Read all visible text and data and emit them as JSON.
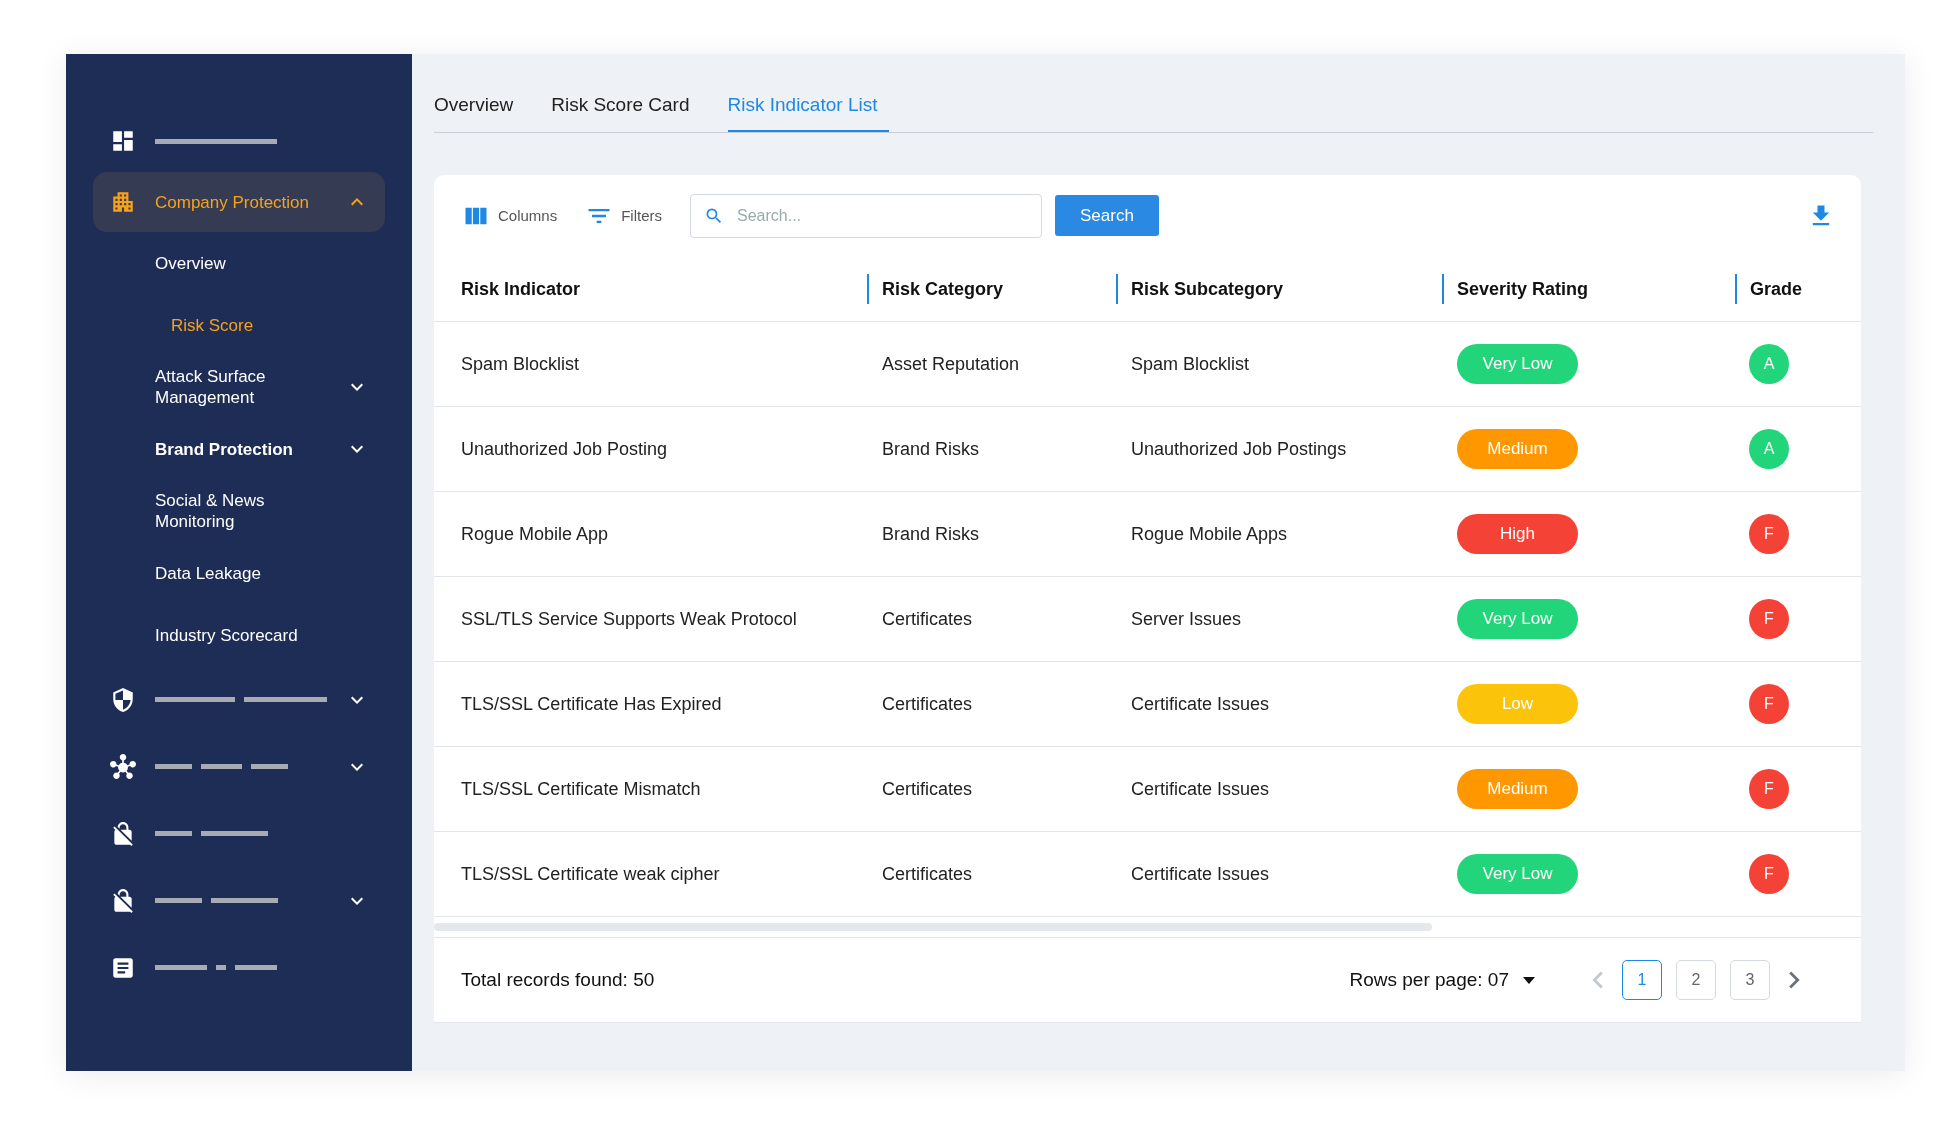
{
  "sidebar": {
    "items": [
      {
        "kind": "dashboard",
        "expandable": false
      },
      {
        "kind": "group",
        "label": "Company Protection",
        "selected": true,
        "expanded": true,
        "children": [
          {
            "label": "Overview",
            "selected": false,
            "expandable": false,
            "children": [
              {
                "label": "Risk Score",
                "selected": true
              }
            ]
          },
          {
            "label": "Attack Surface Management",
            "selected": false,
            "expandable": true
          },
          {
            "label": "Brand Protection",
            "selected": false,
            "expandable": true
          },
          {
            "label": "Social & News Monitoring",
            "selected": false,
            "expandable": false
          },
          {
            "label": "Data Leakage",
            "selected": false,
            "expandable": false
          },
          {
            "label": "Industry Scorecard",
            "selected": false,
            "expandable": false
          }
        ]
      },
      {
        "kind": "shield",
        "expandable": true
      },
      {
        "kind": "hub",
        "expandable": true
      },
      {
        "kind": "no-lock",
        "expandable": false
      },
      {
        "kind": "no-lock",
        "expandable": true
      },
      {
        "kind": "article",
        "expandable": false
      }
    ]
  },
  "tabs": [
    {
      "label": "Overview",
      "selected": false
    },
    {
      "label": "Risk Score Card",
      "selected": false
    },
    {
      "label": "Risk Indicator List",
      "selected": true
    }
  ],
  "toolbar": {
    "columns_button": "Columns",
    "filters_button": "Filters",
    "search": {
      "placeholder": "Search..."
    },
    "search_button": "Search"
  },
  "table": {
    "columns": [
      "Risk Indicator",
      "Risk Category",
      "Risk Subcategory",
      "Severity Rating",
      "Grade"
    ],
    "rows": [
      {
        "indicator": "Spam Blocklist",
        "category": "Asset Reputation",
        "subcategory": "Spam Blocklist",
        "severity": {
          "label": "Very Low",
          "color": "#23d57a"
        },
        "grade": {
          "label": "A",
          "color": "#23d57a"
        }
      },
      {
        "indicator": "Unauthorized Job Posting",
        "category": "Brand Risks",
        "subcategory": "Unauthorized Job Postings",
        "severity": {
          "label": "Medium",
          "color": "#ff9800"
        },
        "grade": {
          "label": "A",
          "color": "#23d57a"
        }
      },
      {
        "indicator": "Rogue Mobile App",
        "category": "Brand Risks",
        "subcategory": "Rogue Mobile Apps",
        "severity": {
          "label": "High",
          "color": "#f44336"
        },
        "grade": {
          "label": "F",
          "color": "#f44336"
        }
      },
      {
        "indicator": "SSL/TLS Service Supports Weak Protocol",
        "category": "Certificates",
        "subcategory": "Server Issues",
        "severity": {
          "label": "Very Low",
          "color": "#23d57a"
        },
        "grade": {
          "label": "F",
          "color": "#f44336"
        }
      },
      {
        "indicator": "TLS/SSL Certificate Has Expired",
        "category": "Certificates",
        "subcategory": "Certificate Issues",
        "severity": {
          "label": "Low",
          "color": "#fbc30a"
        },
        "grade": {
          "label": "F",
          "color": "#f44336"
        }
      },
      {
        "indicator": "TLS/SSL Certificate Mismatch",
        "category": "Certificates",
        "subcategory": "Certificate Issues",
        "severity": {
          "label": "Medium",
          "color": "#ff9800"
        },
        "grade": {
          "label": "F",
          "color": "#f44336"
        }
      },
      {
        "indicator": "TLS/SSL Certificate weak cipher",
        "category": "Certificates",
        "subcategory": "Certificate Issues",
        "severity": {
          "label": "Very Low",
          "color": "#23d57a"
        },
        "grade": {
          "label": "F",
          "color": "#f44336"
        }
      }
    ]
  },
  "footer": {
    "total": "Total records found: 50",
    "rows_per_page": "Rows per page: 07",
    "prev_disabled": true,
    "pages": [
      {
        "label": "1",
        "selected": true
      },
      {
        "label": "2",
        "selected": false
      },
      {
        "label": "3",
        "selected": false
      }
    ]
  }
}
